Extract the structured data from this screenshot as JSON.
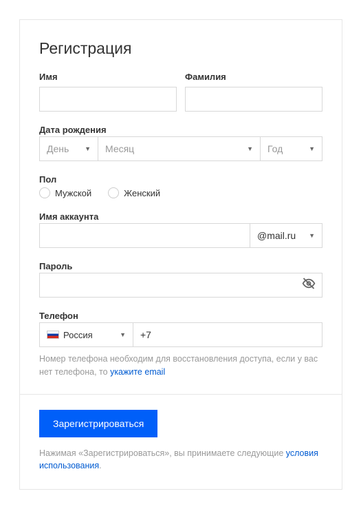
{
  "title": "Регистрация",
  "fields": {
    "firstname": {
      "label": "Имя",
      "value": ""
    },
    "lastname": {
      "label": "Фамилия",
      "value": ""
    },
    "birthday": {
      "label": "Дата рождения",
      "day": "День",
      "month": "Месяц",
      "year": "Год"
    },
    "gender": {
      "label": "Пол",
      "male": "Мужской",
      "female": "Женский"
    },
    "account": {
      "label": "Имя аккаунта",
      "value": "",
      "domain": "@mail.ru"
    },
    "password": {
      "label": "Пароль",
      "value": ""
    },
    "phone": {
      "label": "Телефон",
      "country": "Россия",
      "value": "+7",
      "note_prefix": "Номер телефона необходим для восстановления доступа, если у вас нет телефона, то ",
      "note_link": "укажите email"
    }
  },
  "submit": "Зарегистрироваться",
  "terms": {
    "prefix": "Нажимая «Зарегистрироваться», вы принимаете следующие ",
    "link": "условия использования",
    "suffix": "."
  }
}
